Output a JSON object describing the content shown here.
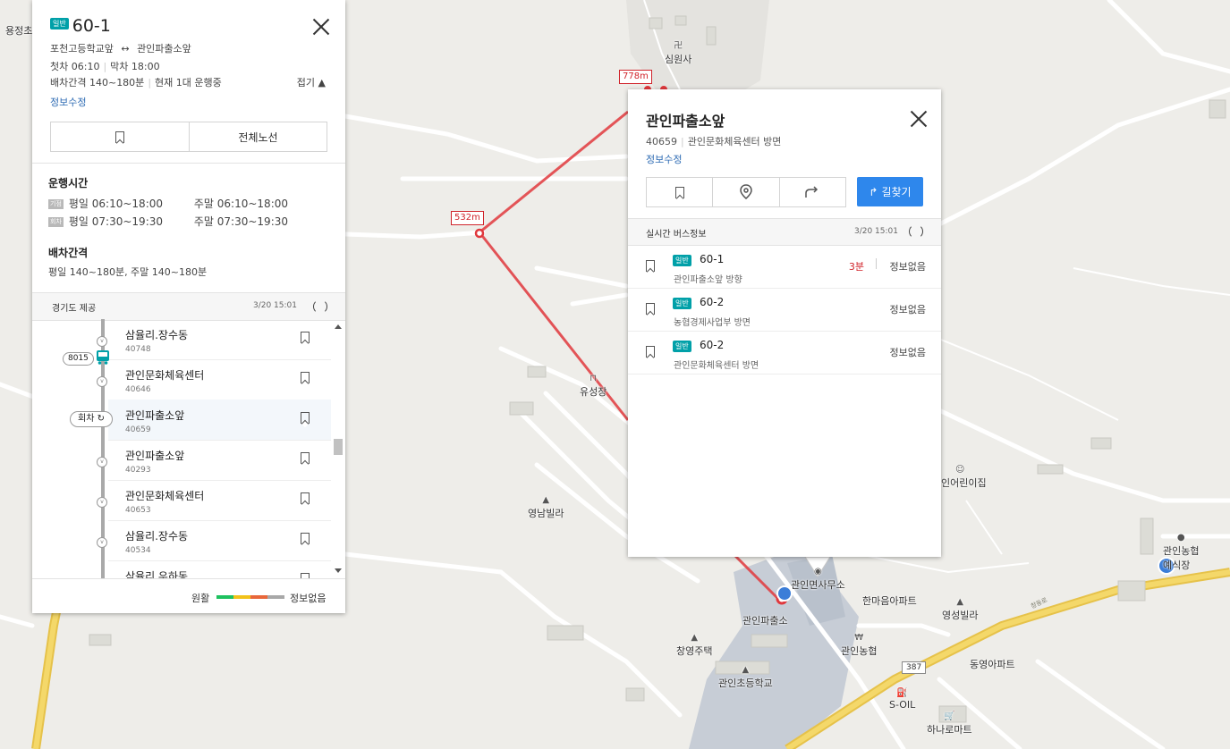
{
  "route_panel": {
    "badge": "일반",
    "route_number": "60-1",
    "start_stop": "포천고등학교앞",
    "arrow": "↔",
    "end_stop": "관인파출소앞",
    "first_bus": "첫차 06:10",
    "last_bus": "막차 18:00",
    "interval": "배차간격 140~180분",
    "operating": "현재 1대 운행중",
    "fold": "접기 ▲",
    "edit_link": "정보수정",
    "full_route_button": "전체노선",
    "operating_title": "운행시간",
    "origin_tag": "기점",
    "origin_weekday": "평일 06:10~18:00",
    "origin_weekend": "주말 06:10~18:00",
    "turn_tag": "회차",
    "turn_weekday": "평일 07:30~19:30",
    "turn_weekend": "주말 07:30~19:30",
    "interval_title": "배차간격",
    "interval_detail": "평일 140~180분, 주말 140~180분",
    "source": "경기도 제공",
    "updated": "3/20 15:01",
    "bus_tag": "8015",
    "turn_marker": "회차",
    "stops": [
      {
        "name": "삼율리.장수동",
        "id": "40748"
      },
      {
        "name": "관인문화체육센터",
        "id": "40646"
      },
      {
        "name": "관인파출소앞",
        "id": "40659"
      },
      {
        "name": "관인파출소앞",
        "id": "40293"
      },
      {
        "name": "관인문화체육센터",
        "id": "40653"
      },
      {
        "name": "삼율리.장수동",
        "id": "40534"
      },
      {
        "name": "삼율리.우하동",
        "id": ""
      }
    ],
    "legend_smooth": "원활",
    "legend_none": "정보없음",
    "legend_colors": [
      "#1ec15f",
      "#f2c21a",
      "#e8673a",
      "#a8a8a8"
    ]
  },
  "stop_popup": {
    "title": "관인파출소앞",
    "stop_id": "40659",
    "direction": "관인문화체육센터 방면",
    "edit_link": "정보수정",
    "directions_button": "길찾기",
    "realtime_title": "실시간 버스정보",
    "updated": "3/20 15:01",
    "buses": [
      {
        "badge": "일반",
        "number": "60-1",
        "direction": "관인파출소앞 방향",
        "arrival": "3분",
        "info": "정보없음"
      },
      {
        "badge": "일반",
        "number": "60-2",
        "direction": "농협경제사업부 방면",
        "arrival": "",
        "info": "정보없음"
      },
      {
        "badge": "일반",
        "number": "60-2",
        "direction": "관인문화체육센터 방면",
        "arrival": "",
        "info": "정보없음"
      }
    ]
  },
  "map": {
    "distance_labels": [
      "778m",
      "532m"
    ],
    "route_shield": "387",
    "road_name": "창동로",
    "places": {
      "temple": "심원사",
      "yongjeong": "용정초",
      "yuseong": "유성장",
      "yeongnam": "영남빌라",
      "kindergarten": "인어린이집",
      "nonghyup_store": "관인농협",
      "nonghyup_store2": "예식장",
      "office": "관인면사무소",
      "police": "관인파출소",
      "hanmaeum": "한마음아파트",
      "youngseong": "영성빌라",
      "changyoung": "창영주택",
      "nonghyup": "관인농협",
      "dongyoung": "동영아파트",
      "school": "관인초등학교",
      "soil": "S-OIL",
      "hanaro": "하나로마트"
    }
  }
}
